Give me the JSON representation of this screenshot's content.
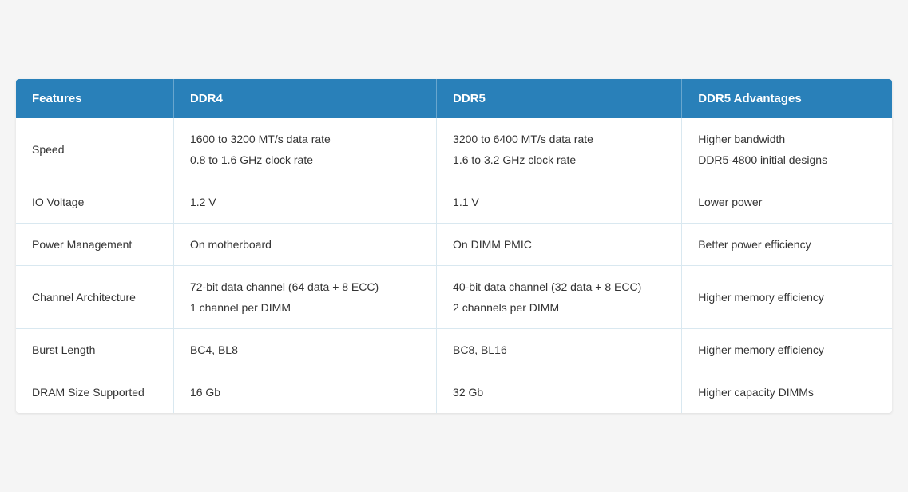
{
  "header": {
    "col1": "Features",
    "col2": "DDR4",
    "col3": "DDR5",
    "col4": "DDR5 Advantages"
  },
  "rows": [
    {
      "feature": "Speed",
      "ddr4": "1600 to 3200 MT/s data rate\n\n0.8 to 1.6 GHz clock rate",
      "ddr5": "3200 to 6400 MT/s data rate\n\n1.6 to 3.2 GHz clock rate",
      "advantage": "Higher bandwidth\n\nDDR5-4800 initial designs",
      "multiline": true
    },
    {
      "feature": "IO Voltage",
      "ddr4": "1.2 V",
      "ddr5": "1.1 V",
      "advantage": "Lower power",
      "multiline": false
    },
    {
      "feature": "Power Management",
      "ddr4": "On motherboard",
      "ddr5": "On DIMM PMIC",
      "advantage": "Better power efficiency",
      "multiline": false
    },
    {
      "feature": "Channel Architecture",
      "ddr4": "72-bit data channel (64 data + 8 ECC)\n\n1 channel per DIMM",
      "ddr5": "40-bit data channel (32 data + 8 ECC)\n\n2 channels per DIMM",
      "advantage": "Higher memory efficiency",
      "multiline": true
    },
    {
      "feature": "Burst Length",
      "ddr4": "BC4, BL8",
      "ddr5": "BC8, BL16",
      "advantage": "Higher memory efficiency",
      "multiline": false
    },
    {
      "feature": "DRAM Size Supported",
      "ddr4": "16 Gb",
      "ddr5": "32 Gb",
      "advantage": "Higher capacity DIMMs",
      "multiline": false
    }
  ]
}
